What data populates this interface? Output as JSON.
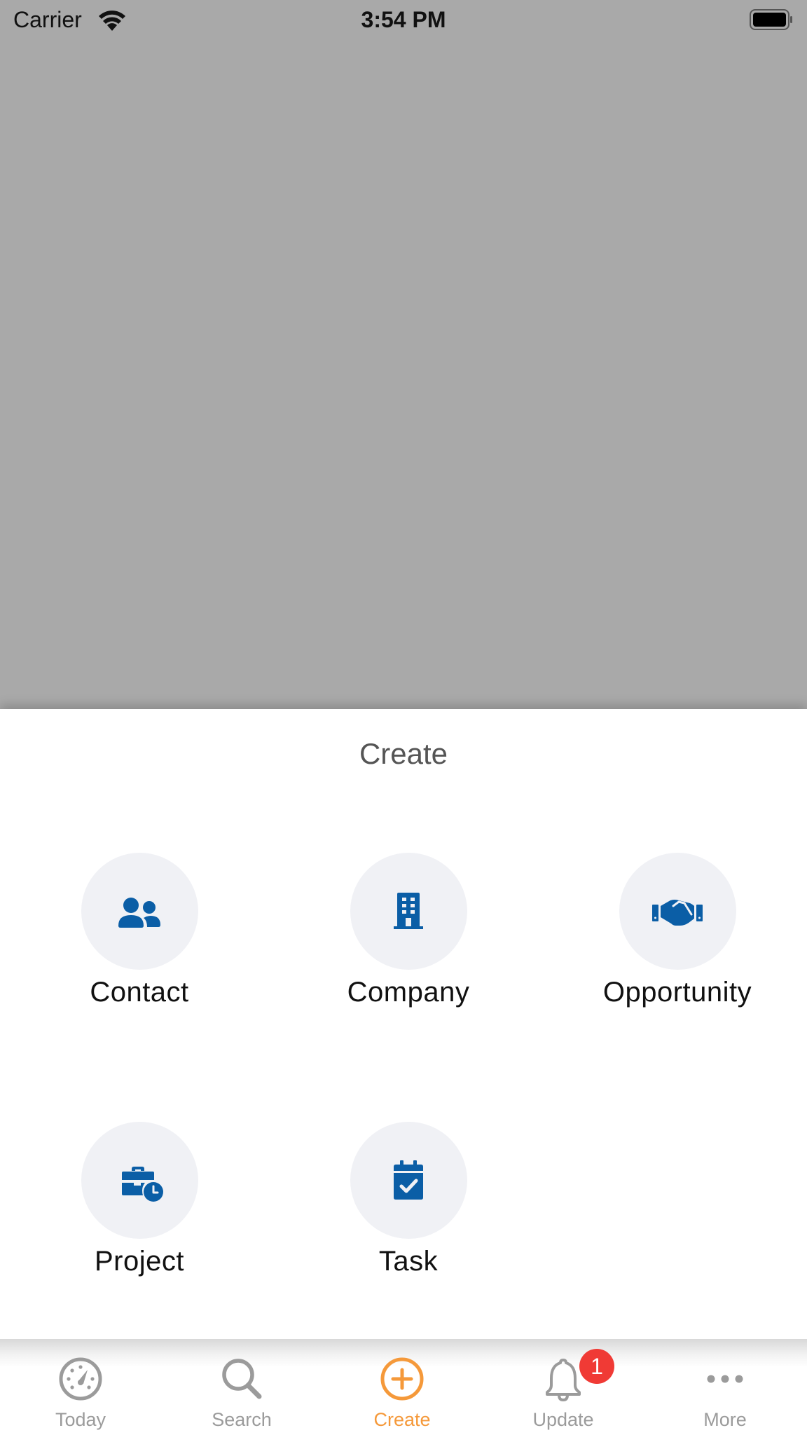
{
  "status_bar": {
    "carrier": "Carrier",
    "time": "3:54 PM",
    "wifi_icon": "wifi-icon",
    "battery_icon": "battery-full-icon"
  },
  "sheet": {
    "title": "Create",
    "options": [
      {
        "label": "Contact",
        "icon": "contacts-icon"
      },
      {
        "label": "Company",
        "icon": "building-icon"
      },
      {
        "label": "Opportunity",
        "icon": "handshake-icon"
      },
      {
        "label": "Project",
        "icon": "briefcase-clock-icon"
      },
      {
        "label": "Task",
        "icon": "calendar-check-icon"
      }
    ],
    "icon_color": "#0b5ea6",
    "circle_color": "#f0f1f5"
  },
  "tab_bar": {
    "active_color": "#f5993a",
    "inactive_color": "#9b9b9b",
    "tabs": [
      {
        "label": "Today",
        "icon": "speedometer-icon",
        "active": false
      },
      {
        "label": "Search",
        "icon": "search-icon",
        "active": false
      },
      {
        "label": "Create",
        "icon": "plus-circle-icon",
        "active": true
      },
      {
        "label": "Update",
        "icon": "bell-icon",
        "active": false,
        "badge": "1"
      },
      {
        "label": "More",
        "icon": "more-dots-icon",
        "active": false
      }
    ]
  }
}
